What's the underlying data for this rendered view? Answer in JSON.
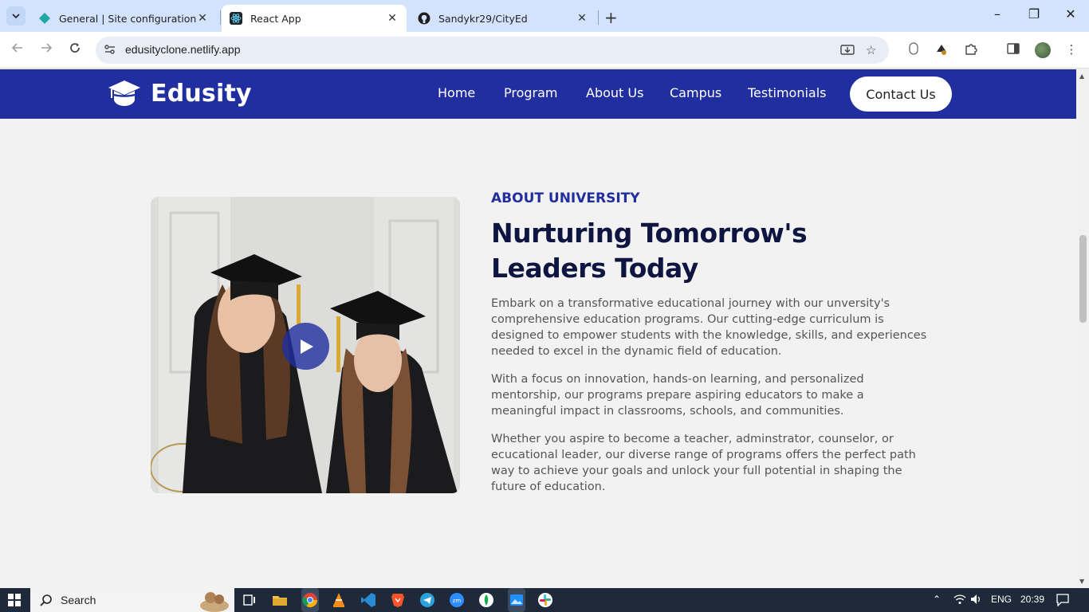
{
  "browser": {
    "tabs": [
      {
        "title": "General | Site configuration | edusityclone",
        "icon": "netlify-icon"
      },
      {
        "title": "React App",
        "icon": "react-icon",
        "active": true
      },
      {
        "title": "Sandykr29/CityEd",
        "icon": "github-icon"
      }
    ],
    "url": "edusityclone.netlify.app"
  },
  "site": {
    "logo_text": "Edusity",
    "nav": [
      "Home",
      "Program",
      "About Us",
      "Campus",
      "Testimonials"
    ],
    "contact_label": "Contact Us"
  },
  "about": {
    "subtitle": "ABOUT UNIVERSITY",
    "headline": "Nurturing Tomorrow's Leaders Today",
    "paragraphs": [
      "Embark on a transformative educational journey with our unversity's comprehensive education programs. Our cutting-edge curriculum is designed to empower students with the knowledge, skills, and experiences needed to excel in the dynamic field of education.",
      "With a focus on innovation, hands-on learning, and personalized mentorship, our programs prepare aspiring educators to make a meaningful impact in classrooms, schools, and communities.",
      "Whether you aspire to become a teacher, adminstrator, counselor, or ecucational leader, our diverse range of programs offers the perfect path way to achieve your goals and unlock your full potential in shaping the future of education."
    ]
  },
  "taskbar": {
    "search_label": "Search",
    "language": "ENG",
    "time": "20:39"
  },
  "colors": {
    "brand": "#212ea0",
    "heading": "#0e1541"
  }
}
